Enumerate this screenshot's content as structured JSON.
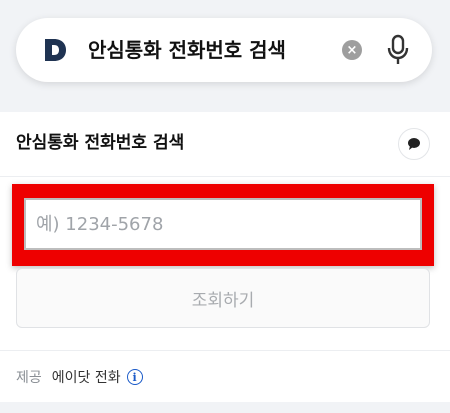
{
  "search": {
    "query": "안심통화 전화번호 검색",
    "clear_icon": "×"
  },
  "widget": {
    "title": "안심통화 전화번호 검색",
    "input_placeholder": "예) 1234-5678",
    "lookup_label": "조회하기",
    "provider_label": "제공",
    "provider_name": "에이닷 전화",
    "info_icon": "i"
  },
  "colors": {
    "brand": "#1f3352",
    "highlight": "#ee0000",
    "info": "#1a5ac8"
  },
  "icons": [
    "daum-logo-icon",
    "clear-icon",
    "mic-icon",
    "feedback-icon",
    "info-icon"
  ]
}
